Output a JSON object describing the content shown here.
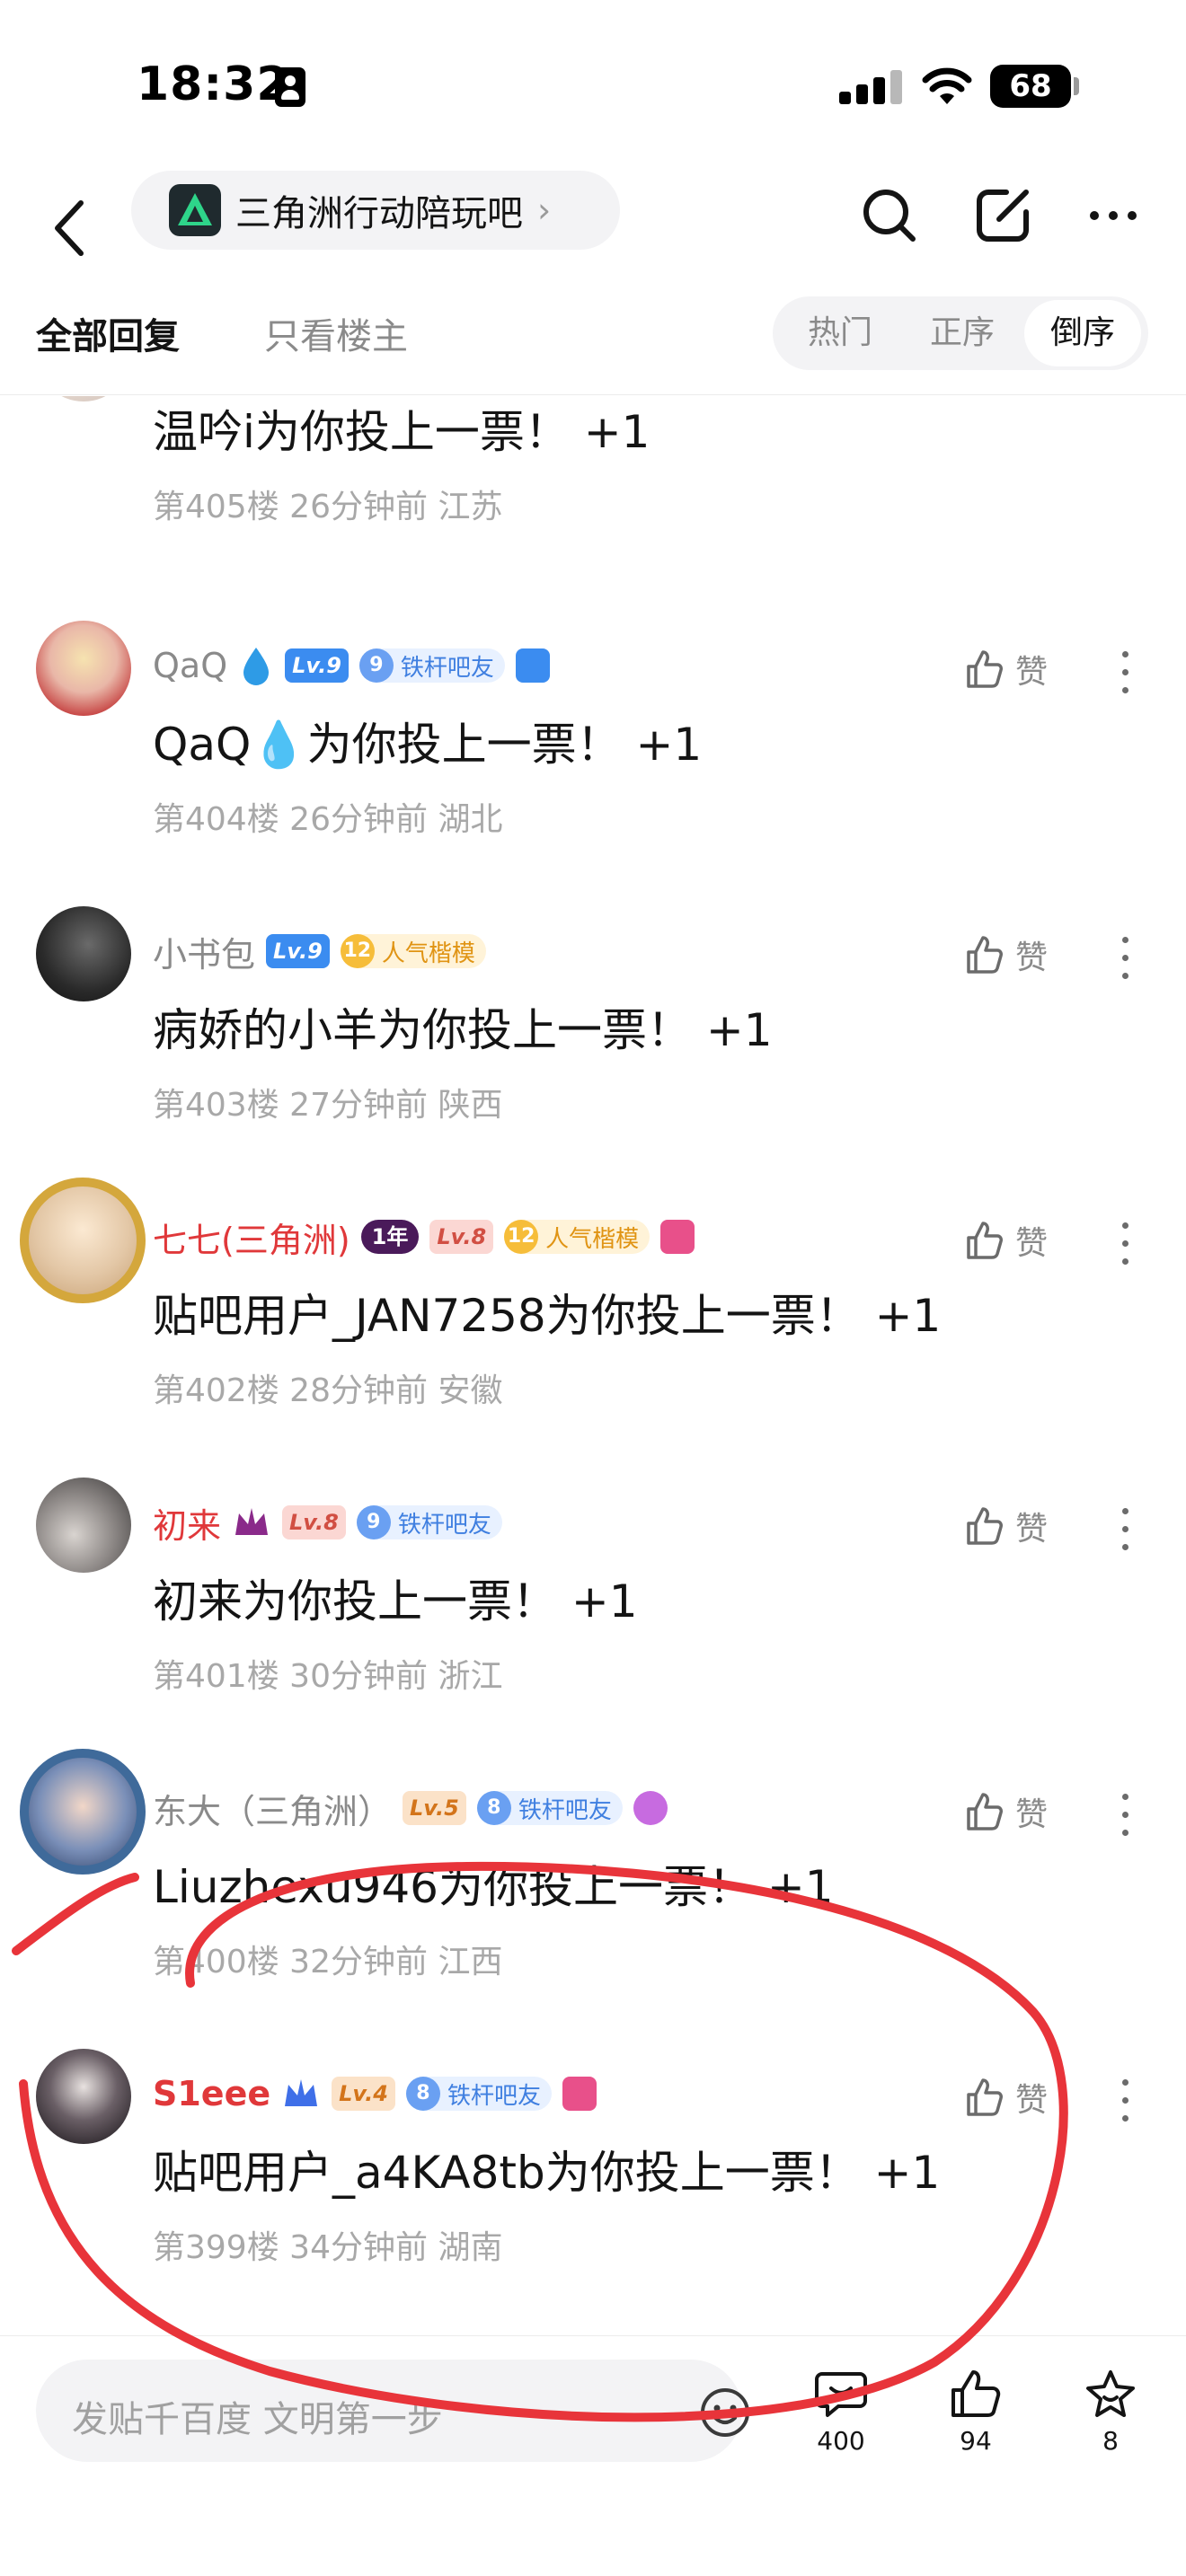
{
  "status_bar": {
    "time": "18:32",
    "battery": "68"
  },
  "nav": {
    "forum_name": "三角洲行动陪玩吧",
    "chevron": "›"
  },
  "tabs": {
    "all_replies": "全部回复",
    "op_only": "只看楼主"
  },
  "sort": {
    "options": [
      "热门",
      "正序",
      "倒序"
    ],
    "selected": "倒序"
  },
  "like_label": "赞",
  "posts": [
    {
      "username": "QaQ",
      "level": "Lv.9",
      "title_num": "9",
      "title": "铁杆吧友",
      "comment": "QaQ💧为你投上一票！ +1",
      "floor": "第404楼",
      "time": "26分钟前",
      "location": "湖北"
    },
    {
      "username": "小书包",
      "level": "Lv.9",
      "title_num": "12",
      "title": "人气楷模",
      "comment": "病娇的小羊为你投上一票！ +1",
      "floor": "第403楼",
      "time": "27分钟前",
      "location": "陕西"
    },
    {
      "username": "七七(三角洲)",
      "badge_years": "1年",
      "level": "Lv.8",
      "title_num": "12",
      "title": "人气楷模",
      "comment": "贴吧用户_JAN7258为你投上一票！ +1",
      "floor": "第402楼",
      "time": "28分钟前",
      "location": "安徽"
    },
    {
      "username": "初来",
      "level": "Lv.8",
      "title_num": "9",
      "title": "铁杆吧友",
      "comment": "初来为你投上一票！ +1",
      "floor": "第401楼",
      "time": "30分钟前",
      "location": "浙江"
    },
    {
      "username": "东大（三角洲）",
      "level": "Lv.5",
      "title_num": "8",
      "title": "铁杆吧友",
      "comment": "Liuzhexu946为你投上一票！ +1",
      "floor": "第400楼",
      "time": "32分钟前",
      "location": "江西"
    },
    {
      "username": "S1eee",
      "level": "Lv.4",
      "title_num": "8",
      "title": "铁杆吧友",
      "comment": "贴吧用户_a4KA8tb为你投上一票！ +1",
      "floor": "第399楼",
      "time": "34分钟前",
      "location": "湖南"
    }
  ],
  "partial_post": {
    "comment": "温吟i为你投上一票！ +1",
    "floor": "第405楼",
    "time": "26分钟前",
    "location": "江苏"
  },
  "bottom": {
    "compose_placeholder": "发贴千百度 文明第一步",
    "comments_count": "400",
    "likes_count": "94",
    "stars_count": "8"
  },
  "colors": {
    "accent_red": "#e0383a",
    "annotation_red": "#e8343a",
    "level_blue": "#3b8cf0",
    "muted_text": "#a8a8a8"
  },
  "icons": [
    "back-icon",
    "search-icon",
    "edit-icon",
    "more-icon",
    "like-icon",
    "comment-icon",
    "star-icon",
    "emoji-icon"
  ]
}
